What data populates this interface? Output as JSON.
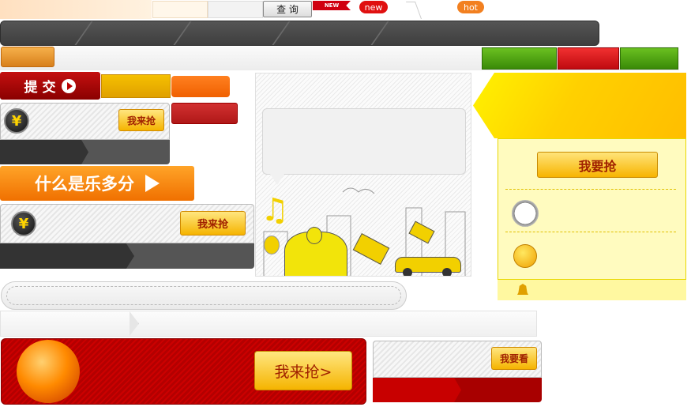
{
  "top": {
    "query_label": "查 询",
    "new_badge": "NEW",
    "new_bubble": "new",
    "hot_bubble": "hot"
  },
  "submit": {
    "label": "提 交"
  },
  "grab": {
    "label_a": "我来抢",
    "label_b": "我来抢",
    "label_big": "我来抢>"
  },
  "banner": {
    "what_label": "什么是乐多分"
  },
  "right_panel": {
    "want_grab": "我要抢"
  },
  "watch": {
    "label": "我要看"
  },
  "yen_symbol": "¥",
  "colors": {
    "accent_red": "#c00000",
    "gold": "#f5b400",
    "green": "#4a9a10",
    "orange": "#ff7a00"
  }
}
